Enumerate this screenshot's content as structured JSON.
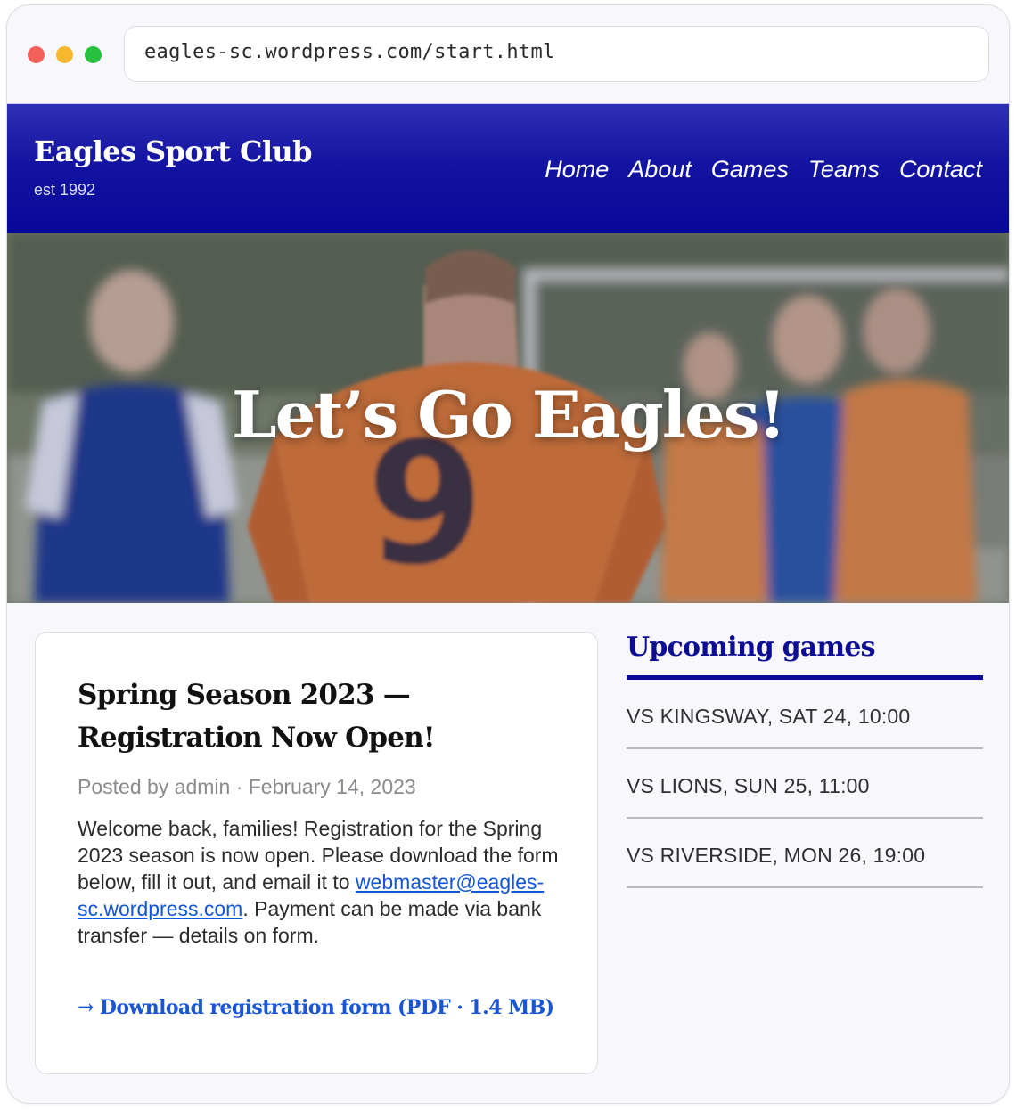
{
  "browser": {
    "url": "eagles-sc.wordpress.com/start.html"
  },
  "header": {
    "site_title": "Eagles Sport Club",
    "tagline": "est 1992",
    "nav": [
      "Home",
      "About",
      "Games",
      "Teams",
      "Contact"
    ]
  },
  "hero": {
    "title": "Let’s Go Eagles!"
  },
  "post": {
    "title": "Spring Season 2023 — Registration Now Open!",
    "meta": "Posted by admin · February 14, 2023",
    "body_before_link": "Welcome back, families! Registration for the Spring 2023 season is now open. Please download the form below, fill it out, and email it to ",
    "email": "webmaster@eagles-sc.wordpress.com",
    "body_after_link": ". Payment can be made via bank transfer — details on form.",
    "download_label": "→ Download registration form (PDF · 1.4 MB)"
  },
  "sidebar": {
    "title": "Upcoming games",
    "games": [
      "VS KINGSWAY, SAT 24, 10:00",
      "VS LIONS, SUN 25, 11:00",
      "VS RIVERSIDE, MON 26, 19:00"
    ]
  },
  "colors": {
    "brand_navy": "#0a0a96",
    "link_blue": "#1a55d6"
  }
}
